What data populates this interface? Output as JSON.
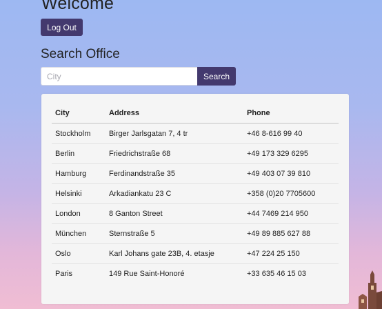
{
  "header": {
    "title": "Welcome",
    "logout_label": "Log Out"
  },
  "search": {
    "title": "Search Office",
    "placeholder": "City",
    "value": "",
    "button_label": "Search"
  },
  "table": {
    "columns": [
      "City",
      "Address",
      "Phone"
    ],
    "rows": [
      [
        "Stockholm",
        "Birger Jarlsgatan 7, 4 tr",
        "+46 8-616 99 40"
      ],
      [
        "Berlin",
        "Friedrichstraße 68",
        "+49 173 329 6295"
      ],
      [
        "Hamburg",
        "Ferdinandstraße 35",
        "+49 403 07 39 810"
      ],
      [
        "Helsinki",
        "Arkadiankatu 23 C",
        "+358 (0)20 7705600"
      ],
      [
        "London",
        "8 Ganton Street",
        "+44 7469 214 950"
      ],
      [
        "München",
        "Sternstraße 5",
        "+49 89 885 627 88"
      ],
      [
        "Oslo",
        "Karl Johans gate 23B, 4. etasje",
        "+47 224 25 150"
      ],
      [
        "Paris",
        "149 Rue Saint-Honoré",
        "+33 635 46 15 03"
      ]
    ]
  },
  "colors": {
    "accent": "#43396e",
    "panel": "#f5f5f5"
  },
  "icons": [
    "city-tower-silhouette"
  ]
}
